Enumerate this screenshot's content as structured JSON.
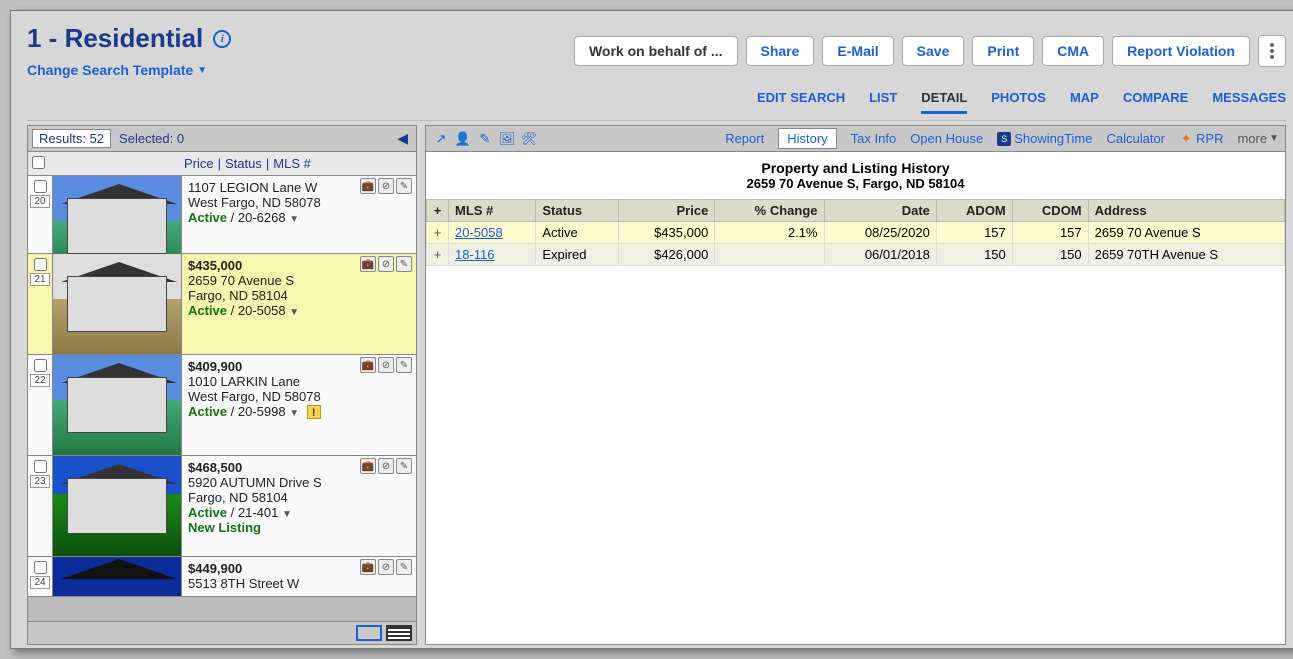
{
  "header": {
    "title": "1 - Residential",
    "change_template": "Change Search Template"
  },
  "top_buttons": {
    "work": "Work on behalf of ...",
    "share": "Share",
    "email": "E-Mail",
    "save": "Save",
    "print": "Print",
    "cma": "CMA",
    "report_violation": "Report Violation"
  },
  "nav": {
    "edit_search": "EDIT SEARCH",
    "list": "LIST",
    "detail": "DETAIL",
    "photos": "PHOTOS",
    "map": "MAP",
    "compare": "COMPARE",
    "messages": "MESSAGES"
  },
  "results_bar": {
    "results": "Results: 52",
    "selected": "Selected: 0"
  },
  "list_header": {
    "price": "Price",
    "status": "Status",
    "mls": "MLS #"
  },
  "listings": [
    {
      "idx": "20",
      "addr1": "1107 LEGION Lane W",
      "addr2": "West Fargo, ND 58078",
      "status": "Active",
      "mls": "20-6268"
    },
    {
      "idx": "21",
      "price": "$435,000",
      "addr1": "2659 70 Avenue S",
      "addr2": "Fargo, ND 58104",
      "status": "Active",
      "mls": "20-5058"
    },
    {
      "idx": "22",
      "price": "$409,900",
      "addr1": "1010 LARKIN Lane",
      "addr2": "West Fargo, ND 58078",
      "status": "Active",
      "mls": "20-5998"
    },
    {
      "idx": "23",
      "price": "$468,500",
      "addr1": "5920 AUTUMN Drive S",
      "addr2": "Fargo, ND 58104",
      "status": "Active",
      "mls": "21-401",
      "new_listing": "New Listing"
    },
    {
      "idx": "24",
      "price": "$449,900",
      "addr1": "5513 8TH Street W"
    }
  ],
  "detail_toolbar": {
    "report": "Report",
    "history": "History",
    "tax_info": "Tax Info",
    "open_house": "Open House",
    "showingtime": "ShowingTime",
    "calculator": "Calculator",
    "rpr": "RPR",
    "more": "more"
  },
  "history": {
    "title": "Property and Listing History",
    "subtitle": "2659 70 Avenue S, Fargo, ND 58104",
    "headers": {
      "plus": "+",
      "mls": "MLS #",
      "status": "Status",
      "price": "Price",
      "pct_change": "% Change",
      "date": "Date",
      "adom": "ADOM",
      "cdom": "CDOM",
      "address": "Address"
    },
    "rows": [
      {
        "mls": "20-5058",
        "status": "Active",
        "price": "$435,000",
        "pct_change": "2.1%",
        "date": "08/25/2020",
        "adom": "157",
        "cdom": "157",
        "address": "2659 70 Avenue S"
      },
      {
        "mls": "18-116",
        "status": "Expired",
        "price": "$426,000",
        "pct_change": "",
        "date": "06/01/2018",
        "adom": "150",
        "cdom": "150",
        "address": "2659 70TH Avenue S"
      }
    ]
  }
}
